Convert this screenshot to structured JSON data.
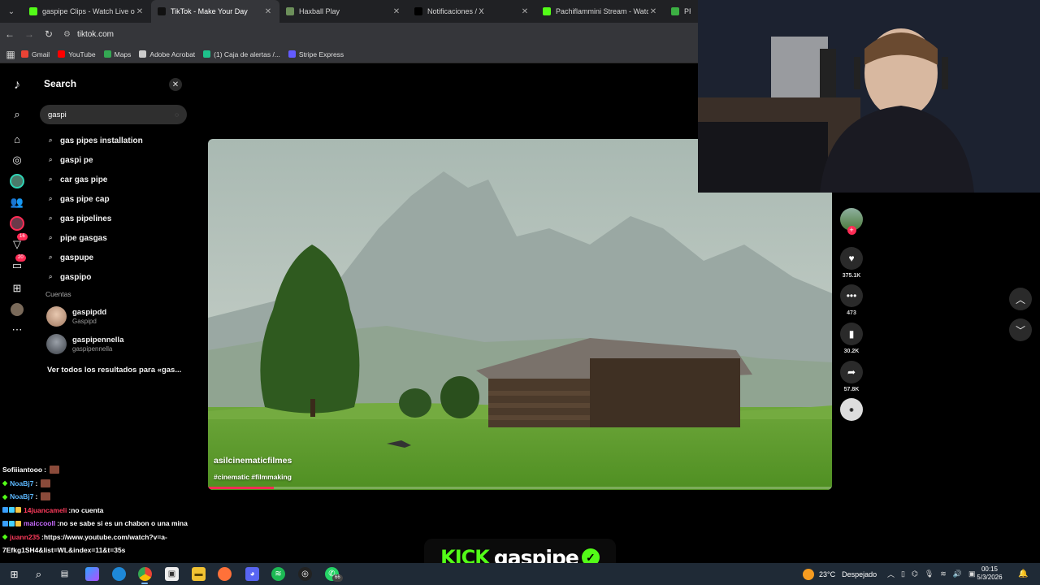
{
  "browser": {
    "tabs": [
      {
        "title": "gaspipe Clips - Watch Live on Kick",
        "favicon_color": "#53fc18",
        "active": false
      },
      {
        "title": "TikTok - Make Your Day",
        "favicon_color": "#111111",
        "active": true
      },
      {
        "title": "Haxball Play",
        "favicon_color": "#6c8f5a",
        "active": false
      },
      {
        "title": "Notificaciones / X",
        "favicon_color": "#000000",
        "active": false
      },
      {
        "title": "Pachiflammini Stream - Watch Live on Kick",
        "favicon_color": "#53fc18",
        "active": false
      },
      {
        "title": "PROM",
        "favicon_color": "#3cb043",
        "active": false
      }
    ],
    "url": "tiktok.com",
    "bookmarks": [
      {
        "label": "Gmail",
        "color": "#ea4335"
      },
      {
        "label": "YouTube",
        "color": "#ff0000"
      },
      {
        "label": "Maps",
        "color": "#34a853"
      },
      {
        "label": "Adobe Acrobat",
        "color": "#cccccc"
      },
      {
        "label": "(1) Caja de alertas /...",
        "color": "#1ec28b"
      },
      {
        "label": "Stripe Express",
        "color": "#635bff"
      }
    ]
  },
  "tiktok": {
    "rail_badges": {
      "activity": "16",
      "messages": "20"
    },
    "search": {
      "title": "Search",
      "query": "gaspi",
      "suggestions": [
        "gas pipes installation",
        "gaspi pe",
        "car gas pipe",
        "gas pipe cap",
        "gas pipelines",
        "pipe gasgas",
        "gaspupe",
        "gaspipo"
      ],
      "accounts_label": "Cuentas",
      "accounts": [
        {
          "name": "gaspipdd",
          "nickname": "Gaspipd"
        },
        {
          "name": "gaspipennella",
          "nickname": "gaspipennella"
        }
      ],
      "see_all": "Ver todos los resultados para «gas..."
    },
    "video": {
      "author": "asilcinematicfilmes",
      "tags": "#cinematic #filmmaking",
      "progress": 0.105
    },
    "actions": {
      "likes": "375.1K",
      "comments": "473",
      "saves": "30.2K",
      "shares": "57.8K"
    }
  },
  "chat": [
    {
      "user": "Sofiiiantooo",
      "msg": "",
      "user_color": "#ffffff",
      "diamond": false,
      "prefix": false,
      "emote": true
    },
    {
      "user": "NoaBj7",
      "msg": "",
      "user_color": "#5cb8ff",
      "diamond": true,
      "prefix": false,
      "emote": true
    },
    {
      "user": "NoaBj7",
      "msg": "",
      "user_color": "#5cb8ff",
      "diamond": true,
      "prefix": false,
      "emote": true
    },
    {
      "user": "14juancameli",
      "msg": "no cuenta",
      "user_color": "#ff3b5c",
      "diamond": false,
      "prefix": true,
      "emote": false
    },
    {
      "user": "maiccooll",
      "msg": "no se sabe si es un chabon o una mina",
      "user_color": "#c86bff",
      "diamond": false,
      "prefix": true,
      "emote": false
    },
    {
      "user": "juann235",
      "msg": "https://www.youtube.com/watch?v=a-",
      "user_color": "#ff3b5c",
      "diamond": true,
      "prefix": false,
      "emote": false
    },
    {
      "user": "",
      "msg": "7Efkg1SH4&list=WL&index=11&t=35s",
      "user_color": "#ffffff",
      "diamond": false,
      "prefix": false,
      "emote": false
    }
  ],
  "kick": {
    "word": "KICK",
    "username": "gaspipe"
  },
  "taskbar": {
    "weather": {
      "temp": "23°C",
      "condition": "Despejado"
    },
    "time": "00:15",
    "date": "5/3/2026",
    "whatsapp_badge": "66"
  }
}
